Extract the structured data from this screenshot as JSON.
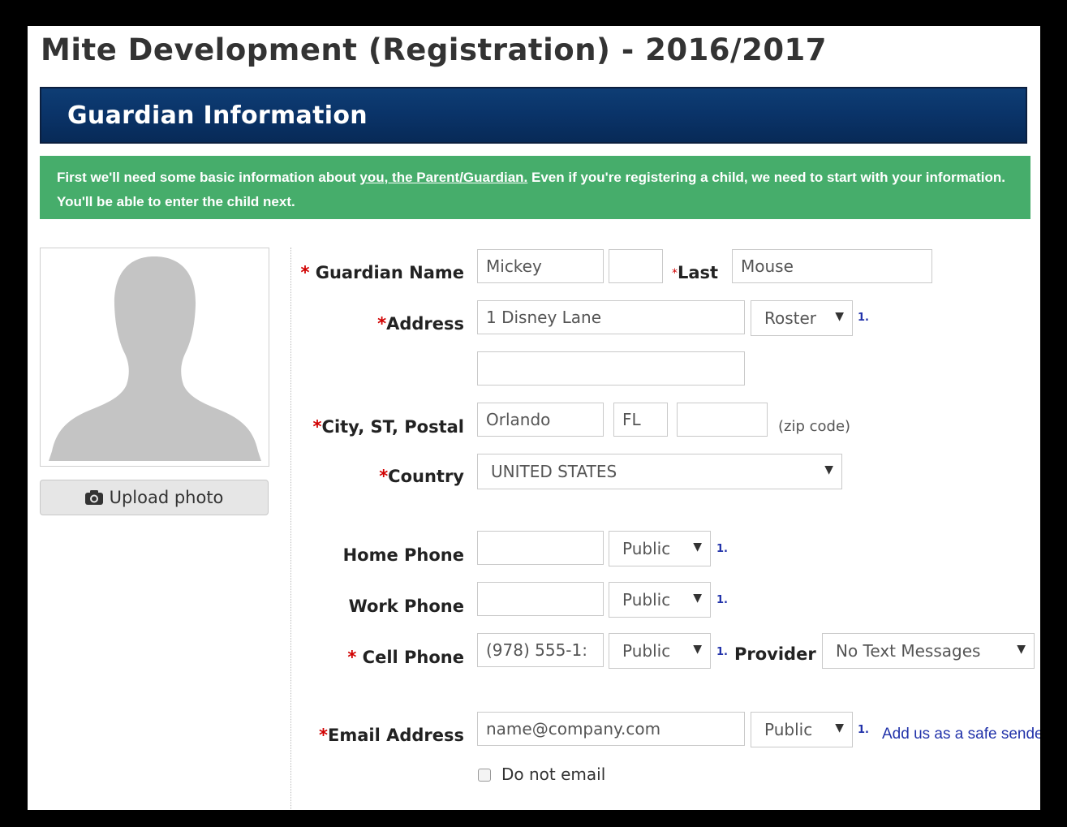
{
  "page_title": "Mite Development (Registration) - 2016/2017",
  "section": {
    "title": "Guardian Information"
  },
  "notice": {
    "text_before": "First we'll need some basic information about ",
    "emphasis": "you, the Parent/Guardian.",
    "text_after": " Even if you're registering a child, we need to start with your information.  You'll be able to enter the child next."
  },
  "photo": {
    "upload_label": "Upload photo",
    "icon": "camera-icon",
    "placeholder_icon": "person-silhouette-icon"
  },
  "form": {
    "required_mark": "*",
    "guardian_name": {
      "label": "Guardian Name",
      "first": "Mickey",
      "middle": "",
      "last_label": "Last",
      "last": "Mouse"
    },
    "address": {
      "label": "Address",
      "line1": "1 Disney Lane",
      "line2": "",
      "visibility": "Roster",
      "note": "1."
    },
    "city_st_postal": {
      "label": "City, ST, Postal",
      "city": "Orlando",
      "state": "FL",
      "postal": "",
      "hint": "(zip code)"
    },
    "country": {
      "label": "Country",
      "value": "UNITED STATES"
    },
    "home_phone": {
      "label": "Home Phone",
      "value": "",
      "visibility": "Public",
      "note": "1."
    },
    "work_phone": {
      "label": "Work Phone",
      "value": "",
      "visibility": "Public",
      "note": "1."
    },
    "cell_phone": {
      "label": "Cell Phone",
      "value": "(978) 555-1:",
      "visibility": "Public",
      "note": "1.",
      "provider_label": "Provider",
      "provider": "No Text Messages"
    },
    "email": {
      "label": "Email Address",
      "value": "name@company.com",
      "visibility": "Public",
      "note": "1.",
      "safe_sender_link": "Add us as a safe sende"
    },
    "do_not_email": {
      "label": "Do not email",
      "checked": false
    }
  },
  "colors": {
    "header_bar": "#0a3368",
    "notice_bg": "#46ad6b",
    "required": "#d10000",
    "link": "#2233aa"
  }
}
